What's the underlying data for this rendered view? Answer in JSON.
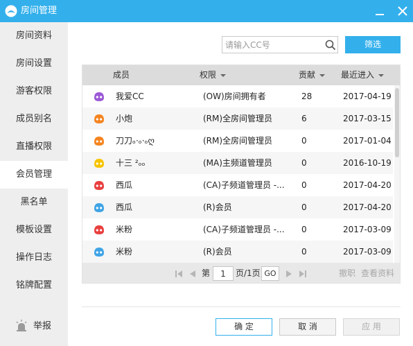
{
  "window": {
    "title": "房间管理"
  },
  "sidebar": {
    "items": [
      {
        "label": "房间资料"
      },
      {
        "label": "房间设置"
      },
      {
        "label": "游客权限"
      },
      {
        "label": "成员别名"
      },
      {
        "label": "直播权限"
      },
      {
        "label": "会员管理",
        "active": true
      },
      {
        "label": "黑名单"
      },
      {
        "label": "模板设置"
      },
      {
        "label": "操作日志"
      },
      {
        "label": "铭牌配置"
      }
    ],
    "report_label": "举报"
  },
  "search": {
    "placeholder": "请输入CC号",
    "value": ""
  },
  "filter_label": "筛选",
  "table": {
    "headers": {
      "member": "成员",
      "role": "权限",
      "contrib": "贡献",
      "recent": "最近进入"
    },
    "rows": [
      {
        "avatar_color": "#9b59d6",
        "name": "我爱CC",
        "role": "(OW)房间拥有者",
        "contrib": "28",
        "date": "2017-04-19"
      },
      {
        "avatar_color": "#f5841f",
        "name": "小炮",
        "role": "(RM)全房间管理员",
        "contrib": "6",
        "date": "2017-03-15"
      },
      {
        "avatar_color": "#f5841f",
        "name": "刀刀ₒ·ₒ·ₒღ",
        "role": "(RM)全房间管理员",
        "contrib": "0",
        "date": "2017-01-04"
      },
      {
        "avatar_color": "#f7c400",
        "name": "十三 ²ₒₒ",
        "role": "(MA)主频道管理员",
        "contrib": "0",
        "date": "2016-10-19"
      },
      {
        "avatar_color": "#e8403f",
        "name": "西瓜",
        "role": "(CA)子频道管理员 -...",
        "contrib": "0",
        "date": "2017-04-20"
      },
      {
        "avatar_color": "#3fa4e6",
        "name": "西瓜",
        "role": "(R)会员",
        "contrib": "0",
        "date": "2017-04-20"
      },
      {
        "avatar_color": "#e8403f",
        "name": "米粉",
        "role": "(CA)子频道管理员 -...",
        "contrib": "0",
        "date": "2017-03-09"
      },
      {
        "avatar_color": "#3fa4e6",
        "name": "米粉",
        "role": "(R)会员",
        "contrib": "0",
        "date": "2017-03-09"
      }
    ]
  },
  "pager": {
    "page_prefix": "第",
    "page_value": "1",
    "page_suffix": "页/1页",
    "go_label": "GO",
    "revoke_label": "撤职",
    "view_profile_label": "查看资料"
  },
  "buttons": {
    "ok": "确 定",
    "cancel": "取 消",
    "apply": "应 用"
  },
  "colors": {
    "accent": "#33b0ec",
    "sidebar_bg": "#eeeeee",
    "header_bg": "#dcdcdc",
    "pager_bg": "#e8e8e8"
  }
}
